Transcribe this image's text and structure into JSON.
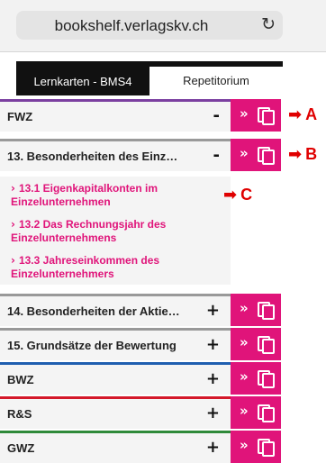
{
  "browser": {
    "url": "bookshelf.verlagskv.ch",
    "reload_icon": "reload-icon"
  },
  "tabs": [
    {
      "label": "Lernkarten - BMS4",
      "active": true
    },
    {
      "label": "Repetitorium",
      "active": false
    }
  ],
  "sections": [
    {
      "title": "FWZ",
      "toggle": "-",
      "accent": "#7b3fa0",
      "marker": "A"
    },
    {
      "title": "13. Besonderheiten des Einz…",
      "toggle": "-",
      "accent": "#999999",
      "marker": "B"
    },
    {
      "title": "14. Besonderheiten der Aktie…",
      "toggle": "+",
      "accent": "#999999"
    },
    {
      "title": "15. Grundsätze der Bewertung",
      "toggle": "+",
      "accent": "#999999"
    },
    {
      "title": "BWZ",
      "toggle": "+",
      "accent": "#1f5fb0"
    },
    {
      "title": "R&S",
      "toggle": "+",
      "accent": "#d4182a"
    },
    {
      "title": "GWZ",
      "toggle": "+",
      "accent": "#2f8a3a"
    }
  ],
  "subitems": [
    {
      "label": "13.1 Eigenkapitalkonten im Einzelunternehmen",
      "color": "#e0147a",
      "marker": "C"
    },
    {
      "label": "13.2 Das Rechnungsjahr des Einzelunternehmens",
      "color": "#e0147a"
    },
    {
      "label": "13.3 Jahreseinkommen des Einzelunternehmers",
      "color": "#e0147a"
    }
  ],
  "action_chevron": "»",
  "colors": {
    "accent_pink": "#e0147a",
    "marker_red": "#e00000"
  }
}
